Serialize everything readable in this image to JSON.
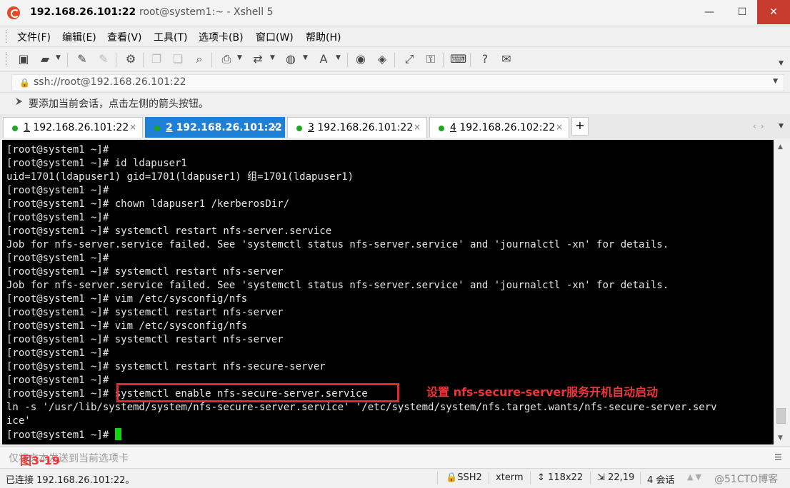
{
  "window": {
    "host_title": "192.168.26.101:22",
    "title_rest": "root@system1:~ - Xshell 5",
    "min_glyph": "—",
    "max_glyph": "☐",
    "close_glyph": "✕"
  },
  "menu": [
    "文件(F)",
    "编辑(E)",
    "查看(V)",
    "工具(T)",
    "选项卡(B)",
    "窗口(W)",
    "帮助(H)"
  ],
  "toolbar_icons": [
    "new-session-icon",
    "open-folder-icon",
    "reconnect-icon",
    "disconnect-icon",
    "properties-icon",
    "copy-icon",
    "paste-icon",
    "find-icon",
    "print-icon",
    "transfer-icon",
    "globe-icon",
    "font-icon",
    "xftp-icon",
    "xagent-icon",
    "fullscreen-icon",
    "lock-icon",
    "keyboard-icon",
    "help-icon",
    "chat-icon"
  ],
  "address": {
    "value": "ssh://root@192.168.26.101:22"
  },
  "hint": {
    "text": "要添加当前会话，点击左侧的箭头按钮。"
  },
  "tabs": [
    {
      "num": "1",
      "label": " 192.168.26.101:22",
      "active": false
    },
    {
      "num": "2",
      "label": " 192.168.26.101:22",
      "active": true
    },
    {
      "num": "3",
      "label": " 192.168.26.101:22",
      "active": false
    },
    {
      "num": "4",
      "label": " 192.168.26.102:22",
      "active": false
    }
  ],
  "tab_close": "×",
  "tab_add": "+",
  "terminal": {
    "lines": [
      "[root@system1 ~]#",
      "[root@system1 ~]# id ldapuser1",
      "uid=1701(ldapuser1) gid=1701(ldapuser1) 组=1701(ldapuser1)",
      "[root@system1 ~]#",
      "[root@system1 ~]# chown ldapuser1 /kerberosDir/",
      "[root@system1 ~]#",
      "[root@system1 ~]# systemctl restart nfs-server.service",
      "Job for nfs-server.service failed. See 'systemctl status nfs-server.service' and 'journalctl -xn' for details.",
      "[root@system1 ~]#",
      "[root@system1 ~]# systemctl restart nfs-server",
      "Job for nfs-server.service failed. See 'systemctl status nfs-server.service' and 'journalctl -xn' for details.",
      "[root@system1 ~]# vim /etc/sysconfig/nfs",
      "[root@system1 ~]# systemctl restart nfs-server",
      "[root@system1 ~]# vim /etc/sysconfig/nfs",
      "[root@system1 ~]# systemctl restart nfs-server",
      "[root@system1 ~]#",
      "[root@system1 ~]# systemctl restart nfs-secure-server",
      "[root@system1 ~]#",
      "[root@system1 ~]# systemctl enable nfs-secure-server.service",
      "ln -s '/usr/lib/systemd/system/nfs-secure-server.service' '/etc/systemd/system/nfs.target.wants/nfs-secure-server.serv",
      "ice'",
      "[root@system1 ~]# "
    ],
    "cursor_color": "#14d214"
  },
  "annotation": {
    "note": "设置 nfs-secure-server服务开机自动启动",
    "figure_label": "图3-19",
    "color": "#f0353a"
  },
  "sendbar": {
    "text": "仅将文本发送到当前选项卡"
  },
  "status": {
    "connected": "已连接 192.168.26.101:22。",
    "protocol": "SSH2",
    "term": "xterm",
    "size": "118x22",
    "position": "22,19",
    "sessions": "4 会话",
    "watermark": "@51CTO博客"
  },
  "colors": {
    "tab_active": "#1e7fd6",
    "close_button": "#c73b2e",
    "terminal_bg": "#000000"
  }
}
